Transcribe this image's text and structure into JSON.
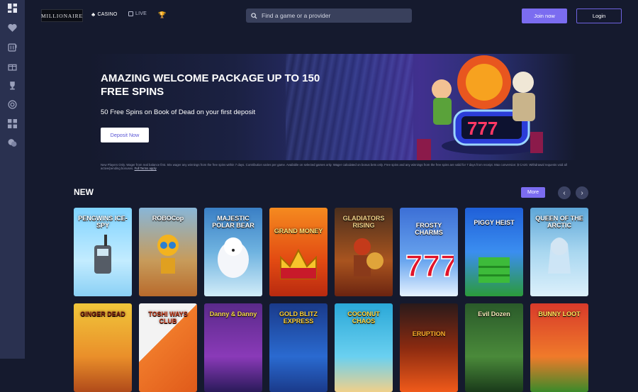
{
  "brand": {
    "logo_text": "MILLIONAIRE"
  },
  "nav": {
    "casino": "CASINO",
    "live": "LIVE"
  },
  "search": {
    "placeholder": "Find a game or a provider"
  },
  "auth": {
    "join": "Join now",
    "login": "Login"
  },
  "sidebar": {
    "icons": [
      "grid-icon",
      "heart-icon",
      "slot-machine-icon",
      "gift-icon",
      "trophy-icon",
      "target-icon",
      "apps-icon",
      "chat-icon"
    ]
  },
  "hero": {
    "title": "AMAZING WELCOME PACKAGE UP TO 150 FREE SPINS",
    "subtitle": "50 Free Spins on Book of Dead on your first deposit",
    "cta": "Deposit Now",
    "terms": "New Players Only. Wager from real balance first. 50x wager any winnings from the free spins within 7 days. Contribution varies per game. Available on selected games only. Wager calculated on bonus bets only. Free spins and any winnings from the free spins are valid for 7 days from receipt. Max conversion: $ CA20. Withdrawal requests void all active/pending bonuses.",
    "terms_link": "Full Terms apply"
  },
  "new_section": {
    "title": "NEW",
    "more": "More",
    "prev": "‹",
    "next": "›"
  },
  "games_row1": [
    {
      "name": "PENGWINS ICE-SPY"
    },
    {
      "name": "ROBOCop"
    },
    {
      "name": "MAJESTIC POLAR BEAR"
    },
    {
      "name": "GRAND MONEY"
    },
    {
      "name": "GLADIATORS RISING"
    },
    {
      "name": "FROSTY CHARMS"
    },
    {
      "name": "PIGGY HEIST"
    },
    {
      "name": "QUEEN OF THE ARCTIC"
    }
  ],
  "games_row2": [
    {
      "name": "GINGER DEAD"
    },
    {
      "name": "TOSHI WAYS CLUB"
    },
    {
      "name": "Danny & Danny"
    },
    {
      "name": "GOLD BLITZ EXPRESS"
    },
    {
      "name": "COCONUT CHAOS"
    },
    {
      "name": "ERUPTION"
    },
    {
      "name": "Evil Dozen"
    },
    {
      "name": "BUNNY LOOT"
    }
  ],
  "colors": {
    "accent": "#7b6cf0",
    "background": "#151a2e",
    "sidebar": "#2a3150"
  }
}
